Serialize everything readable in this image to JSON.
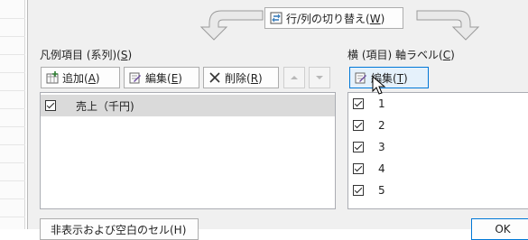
{
  "switch_row_col": {
    "label": "行/列の切り替え(",
    "accel": "W",
    "tail": ")"
  },
  "legend": {
    "heading": "凡例項目 (系列)(",
    "heading_accel": "S",
    "heading_tail": ")",
    "add_label": "追加(",
    "add_accel": "A",
    "add_tail": ")",
    "edit_label": "編集(",
    "edit_accel": "E",
    "edit_tail": ")",
    "delete_label": "削除(",
    "delete_accel": "R",
    "delete_tail": ")",
    "series": [
      {
        "name": "売上（千円)",
        "checked": true
      }
    ]
  },
  "axis": {
    "heading": "横 (項目) 軸ラベル(",
    "heading_accel": "C",
    "heading_tail": ")",
    "edit_label": "編集(",
    "edit_accel": "T",
    "edit_tail": ")",
    "items": [
      {
        "label": "1",
        "checked": true
      },
      {
        "label": "2",
        "checked": true
      },
      {
        "label": "3",
        "checked": true
      },
      {
        "label": "4",
        "checked": true
      },
      {
        "label": "5",
        "checked": true
      }
    ]
  },
  "bottom": {
    "hidden_cells_label": "非表示および空白のセル(H)",
    "ok_label": "OK"
  },
  "colors": {
    "selection": "#cce8ff",
    "selected_row": "#dadada",
    "accent": "#0078d7"
  }
}
